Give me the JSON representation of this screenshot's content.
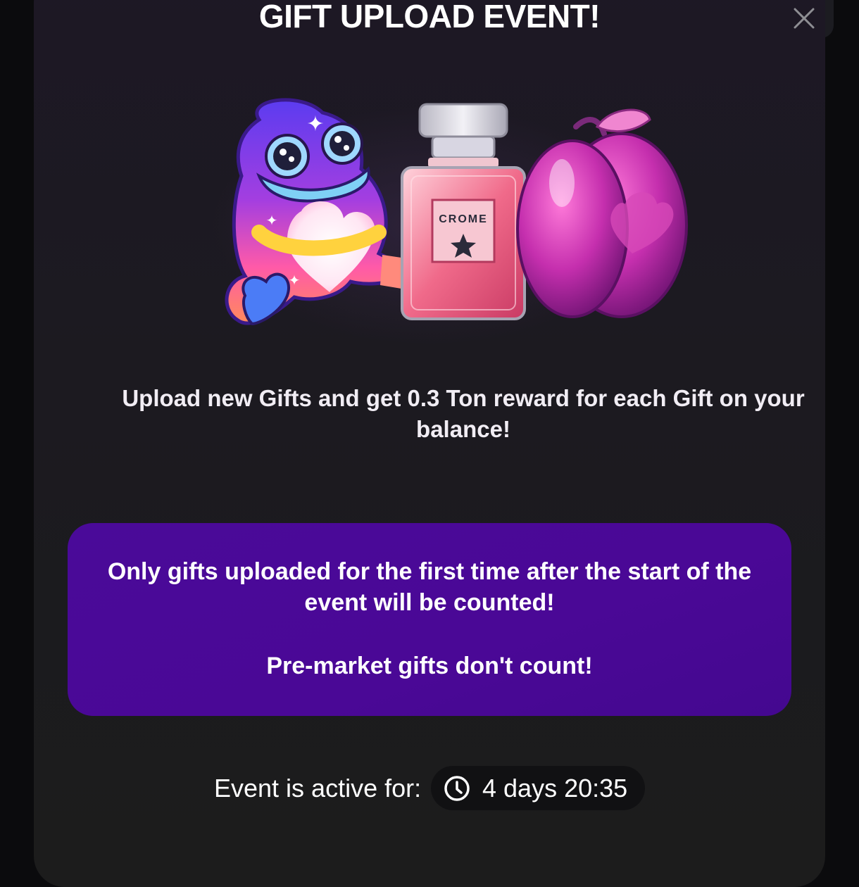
{
  "modal": {
    "title": "GIFT UPLOAD EVENT!",
    "close_icon": "close-icon",
    "hero_images": [
      "frog-gift-icon",
      "perfume-gift-icon",
      "plum-gift-icon"
    ],
    "perfume_label": "CROME",
    "description": "Upload new Gifts and get 0.3 Ton reward for each Gift on your balance!",
    "notice": {
      "line1": "Only gifts uploaded for the first time after the start of the event will be counted!",
      "line2": "Pre-market gifts don't count!",
      "background": "#4a0a99"
    },
    "timer": {
      "label": "Event is active for:",
      "icon": "clock-icon",
      "value": "4 days 20:35"
    }
  }
}
